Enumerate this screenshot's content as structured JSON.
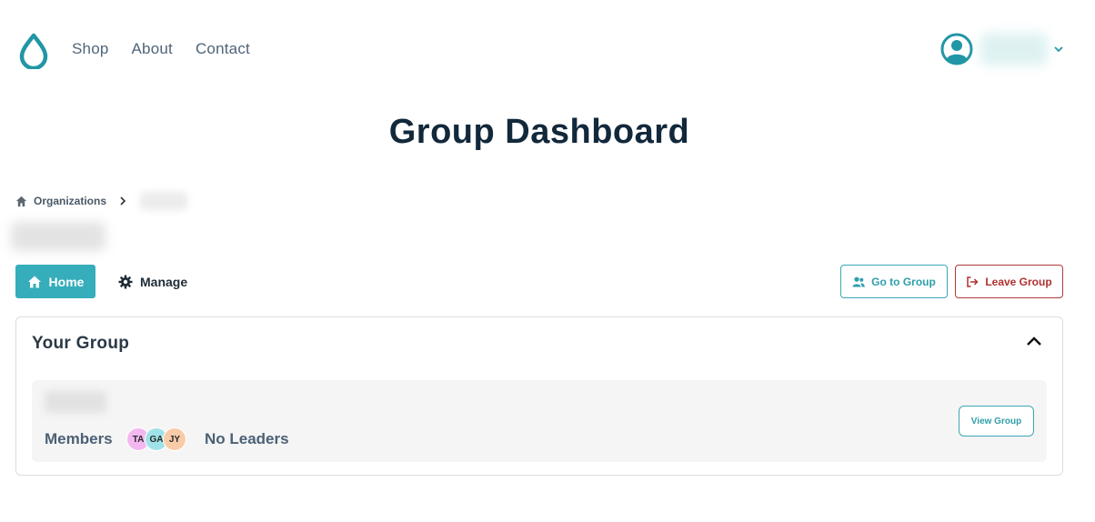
{
  "header": {
    "nav": [
      "Shop",
      "About",
      "Contact"
    ],
    "brand_color": "#2196a6"
  },
  "page": {
    "title": "Group Dashboard"
  },
  "breadcrumb": {
    "root": "Organizations"
  },
  "tabs": {
    "home": "Home",
    "manage": "Manage"
  },
  "actions": {
    "go_to_group": "Go to Group",
    "leave_group": "Leave Group"
  },
  "card": {
    "title": "Your Group",
    "members_label": "Members",
    "members": [
      {
        "initials": "TA",
        "color": "#f4b8f0"
      },
      {
        "initials": "GA",
        "color": "#9fe3e8"
      },
      {
        "initials": "JY",
        "color": "#f9cba8"
      }
    ],
    "leaders_label": "No Leaders",
    "view_button": "View Group"
  },
  "colors": {
    "accent": "#36adba",
    "danger": "#b03030",
    "heading": "#12283b"
  }
}
